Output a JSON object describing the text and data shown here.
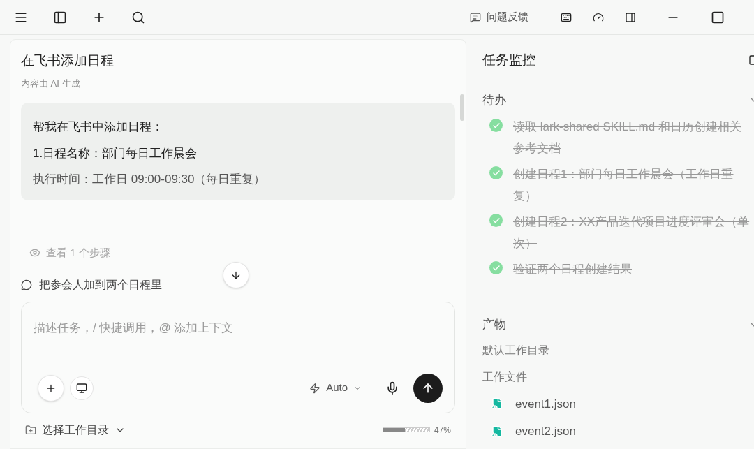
{
  "toolbar": {
    "feedback": "问题反馈"
  },
  "chat": {
    "title": "在飞书添加日程",
    "subtitle": "内容由 AI 生成",
    "message_lines": [
      "帮我在飞书中添加日程：",
      "1.日程名称：部门每日工作晨会",
      "执行时间：工作日 09:00-09:30（每日重复）"
    ],
    "steps_link": "查看 1 个步骤",
    "suggestion": "把参会人加到两个日程里",
    "composer": {
      "placeholder": "描述任务，/ 快捷调用，@ 添加上下文",
      "mode": "Auto"
    },
    "workdir": "选择工作目录",
    "context": {
      "level": 0.47,
      "reading": "47%"
    }
  },
  "monitor": {
    "title": "任务监控",
    "todo": {
      "title": "待办",
      "expanded": true,
      "items": [
        {
          "text": "读取 lark-shared SKILL.md 和日历创建相关参考文档",
          "done": true
        },
        {
          "text": "创建日程1：部门每日工作晨会（工作日重复）",
          "done": true
        },
        {
          "text": "创建日程2：XX产品迭代项目进度评审会（单次）",
          "done": true
        },
        {
          "text": "验证两个日程创建结果",
          "done": true
        }
      ]
    },
    "outputs": {
      "title": "产物",
      "expanded": true,
      "default_dir": "默认工作目录",
      "files_title": "工作文件",
      "files": [
        "event1.json",
        "event2.json"
      ]
    }
  }
}
